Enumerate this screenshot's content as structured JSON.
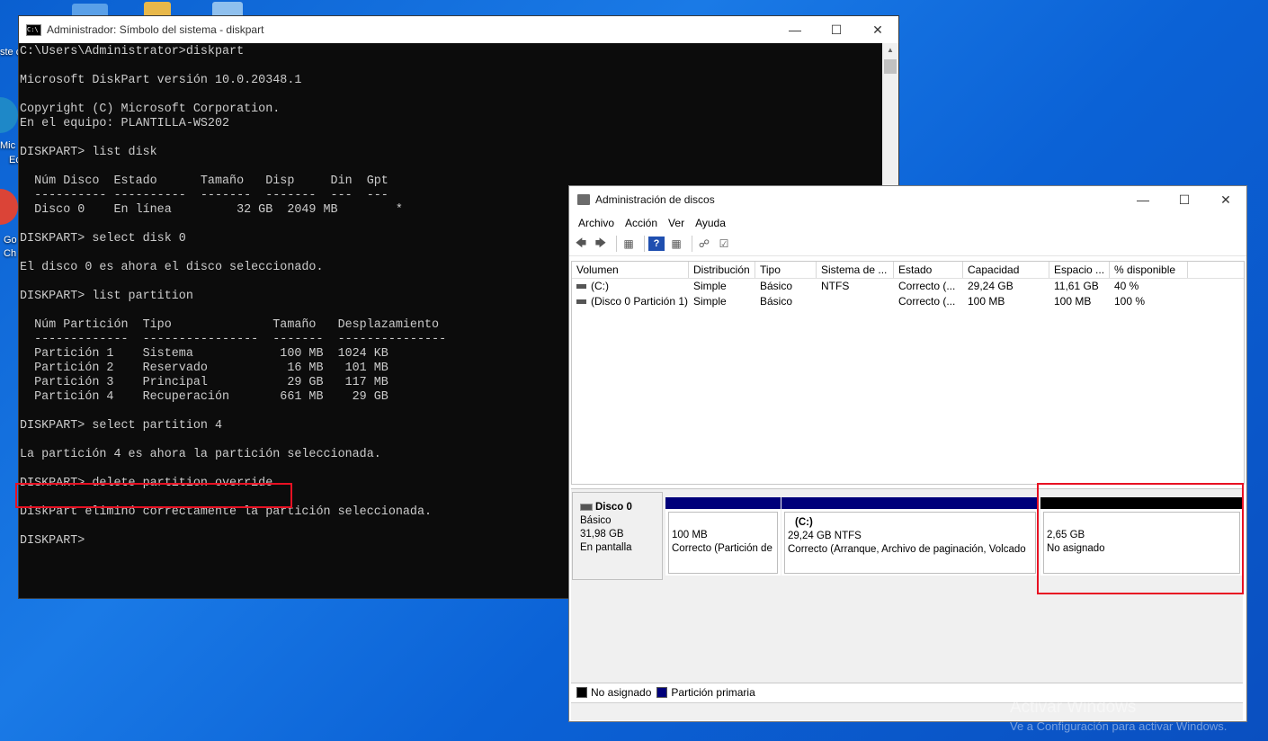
{
  "desktop": {
    "icon_labels": [
      "ste c",
      "Mic",
      "Ec",
      "Go",
      "Ch"
    ],
    "watermark_title": "Activar Windows",
    "watermark_sub": "Ve a Configuración para activar Windows."
  },
  "cmd_window": {
    "title": "Administrador: Símbolo del sistema - diskpart",
    "icon_text": "C:\\",
    "lines": [
      "C:\\Users\\Administrator>diskpart",
      "",
      "Microsoft DiskPart versión 10.0.20348.1",
      "",
      "Copyright (C) Microsoft Corporation.",
      "En el equipo: PLANTILLA-WS202",
      "",
      "DISKPART> list disk",
      "",
      "  Núm Disco  Estado      Tamaño   Disp     Din  Gpt",
      "  ---------- ----------  -------  -------  ---  ---",
      "  Disco 0    En línea         32 GB  2049 MB        *",
      "",
      "DISKPART> select disk 0",
      "",
      "El disco 0 es ahora el disco seleccionado.",
      "",
      "DISKPART> list partition",
      "",
      "  Núm Partición  Tipo              Tamaño   Desplazamiento",
      "  -------------  ----------------  -------  ---------------",
      "  Partición 1    Sistema            100 MB  1024 KB",
      "  Partición 2    Reservado           16 MB   101 MB",
      "  Partición 3    Principal           29 GB   117 MB",
      "  Partición 4    Recuperación       661 MB    29 GB",
      "",
      "DISKPART> select partition 4",
      "",
      "La partición 4 es ahora la partición seleccionada.",
      "",
      "DISKPART> delete partition override",
      "",
      "DiskPart eliminó correctamente la partición seleccionada.",
      "",
      "DISKPART>"
    ]
  },
  "disk_mgmt": {
    "title": "Administración de discos",
    "menu": [
      "Archivo",
      "Acción",
      "Ver",
      "Ayuda"
    ],
    "columns": [
      "Volumen",
      "Distribución",
      "Tipo",
      "Sistema de ...",
      "Estado",
      "Capacidad",
      "Espacio ...",
      "% disponible"
    ],
    "volumes": [
      [
        "(C:)",
        "Simple",
        "Básico",
        "NTFS",
        "Correcto (...",
        "29,24 GB",
        "11,61 GB",
        "40 %"
      ],
      [
        "(Disco 0 Partición 1)",
        "Simple",
        "Básico",
        "",
        "Correcto (...",
        "100 MB",
        "100 MB",
        "100 %"
      ]
    ],
    "disk": {
      "name": "Disco 0",
      "type": "Básico",
      "size": "31,98 GB",
      "status": "En pantalla"
    },
    "partitions": [
      {
        "label": "",
        "size": "100 MB",
        "status": "Correcto (Partición de",
        "kind": "primary"
      },
      {
        "label": "(C:)",
        "size": "29,24 GB NTFS",
        "status": "Correcto (Arranque, Archivo de paginación, Volcado",
        "kind": "primary"
      },
      {
        "label": "",
        "size": "2,65 GB",
        "status": "No asignado",
        "kind": "unallocated"
      }
    ],
    "legend": [
      "No asignado",
      "Partición primaria"
    ],
    "colors": {
      "primary": "#00007a",
      "unallocated": "#000000",
      "highlight": "#e81123"
    }
  }
}
